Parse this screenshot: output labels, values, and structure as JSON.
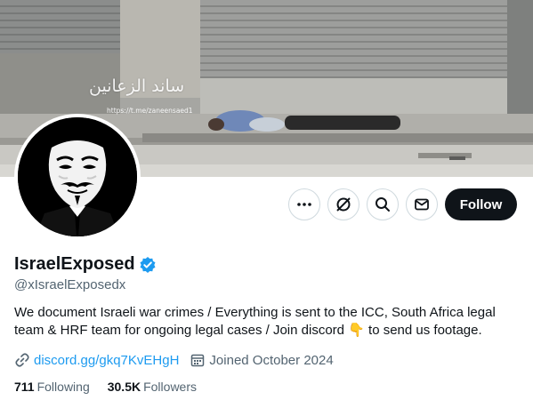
{
  "banner": {
    "watermark_arabic": "ساند الزعانين",
    "watermark_url": "https://t.me/zaneensaed1"
  },
  "profile": {
    "display_name": "IsraelExposed",
    "handle": "@xIsraelExposedx",
    "verified": true,
    "verified_color": "#1d9bf0",
    "bio_text": "We document Israeli war crimes / Everything is sent to the ICC, South Africa legal team & HRF team for ongoing legal cases / Join discord",
    "bio_emoji": "👇",
    "bio_suffix": " to send us footage.",
    "link_text": "discord.gg/gkq7KvEHgH",
    "joined_text": "Joined October 2024",
    "following_count": "711",
    "following_label": "Following",
    "followers_count": "30.5K",
    "followers_label": "Followers"
  },
  "actions": {
    "more_icon": "more-dots-icon",
    "grok_icon": "grok-icon",
    "search_icon": "search-icon",
    "message_icon": "mail-icon",
    "follow_label": "Follow"
  },
  "colors": {
    "accent": "#1d9bf0",
    "primary_text": "#0f1419",
    "secondary_text": "#536471",
    "follow_bg": "#0f1419"
  }
}
